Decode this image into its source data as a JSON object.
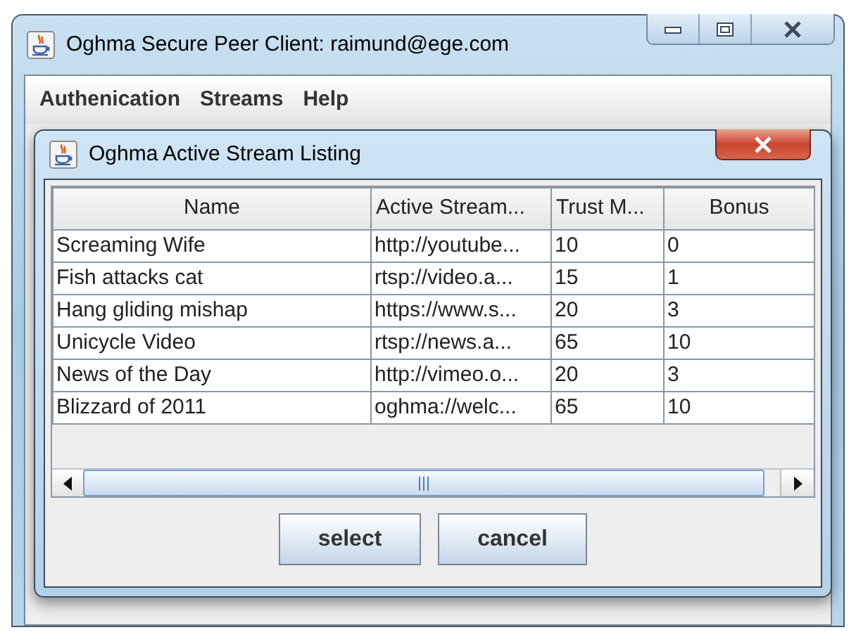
{
  "window": {
    "title": "Oghma Secure Peer Client: raimund@ege.com"
  },
  "menu": [
    "Authenication",
    "Streams",
    "Help"
  ],
  "dialog": {
    "title": "Oghma Active Stream Listing",
    "table": {
      "columns": [
        "Name",
        "Active Stream...",
        "Trust M...",
        "Bonus"
      ],
      "rows": [
        [
          "Screaming Wife",
          "http://youtube...",
          "10",
          "0"
        ],
        [
          "Fish attacks cat",
          "rtsp://video.a...",
          "15",
          "1"
        ],
        [
          "Hang gliding mishap",
          "https://www.s...",
          "20",
          "3"
        ],
        [
          "Unicycle Video",
          "rtsp://news.a...",
          "65",
          "10"
        ],
        [
          "News of the Day",
          "http://vimeo.o...",
          "20",
          "3"
        ],
        [
          "Blizzard of 2011",
          "oghma://welc...",
          "65",
          "10"
        ]
      ]
    },
    "buttons": [
      "select",
      "cancel"
    ]
  }
}
